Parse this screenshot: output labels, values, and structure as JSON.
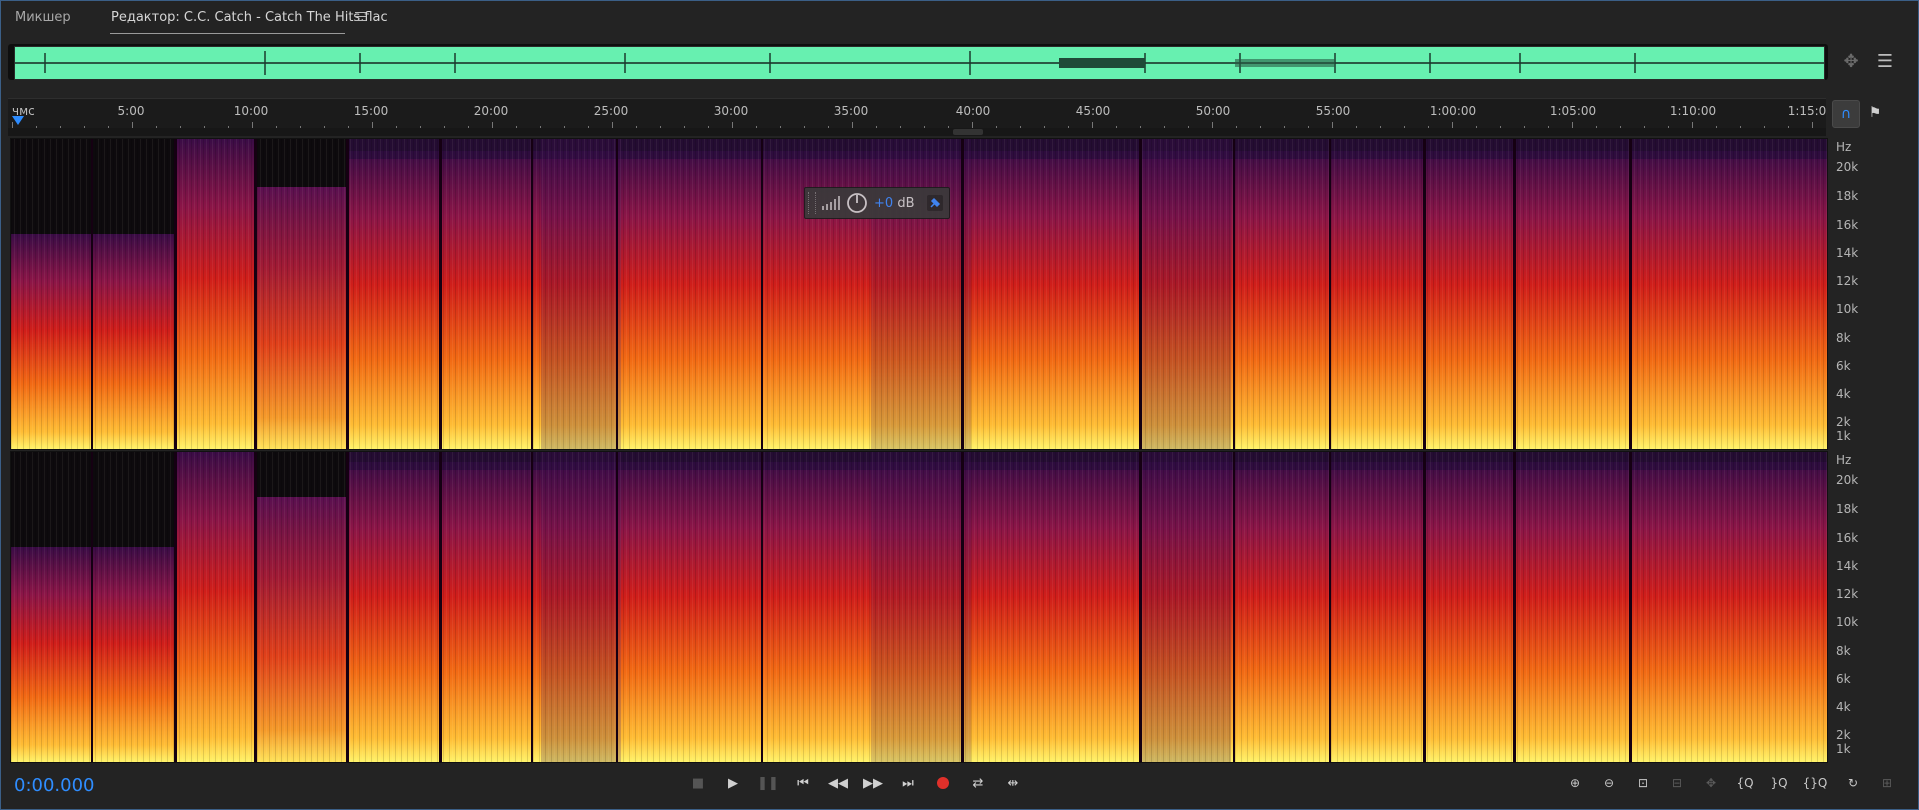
{
  "tabs": {
    "mixer_label": "Микшер",
    "editor_label": "Редактор: C.C. Catch - Catch The Hits.flac"
  },
  "ruler": {
    "start_label": "чмс",
    "marks": [
      "5:00",
      "10:00",
      "15:00",
      "20:00",
      "25:00",
      "30:00",
      "35:00",
      "40:00",
      "45:00",
      "50:00",
      "55:00",
      "1:00:00",
      "1:05:00",
      "1:10:00",
      "1:15:0"
    ]
  },
  "spectral": {
    "unit_label": "Hz",
    "freq_labels": [
      "20k",
      "18k",
      "16k",
      "14k",
      "12k",
      "10k",
      "8k",
      "6k",
      "4k",
      "2k",
      "1k"
    ]
  },
  "hud": {
    "db_value": "+0",
    "db_unit": "dB"
  },
  "status": {
    "timecode": "0:00.000"
  },
  "colors": {
    "accent": "#2f8dff",
    "waveform": "#67f0b0",
    "record": "#e0302a",
    "frame": "#3b5f87"
  },
  "icons": {
    "transport": [
      "stop-icon",
      "play-icon",
      "pause-icon",
      "skip-to-start-icon",
      "rewind-icon",
      "fast-forward-icon",
      "skip-to-end-icon",
      "record-icon",
      "loop-icon",
      "skip-selection-icon"
    ],
    "zoom": [
      "zoom-in-amplitude-icon",
      "zoom-out-amplitude-icon",
      "zoom-to-selection-icon",
      "zoom-out-full-icon",
      "zoom-in-time-icon",
      "zoom-in-left-icon",
      "zoom-in-right-icon",
      "zoom-out-time-icon",
      "zoom-reset-icon",
      "zoom-selection-icon"
    ]
  }
}
